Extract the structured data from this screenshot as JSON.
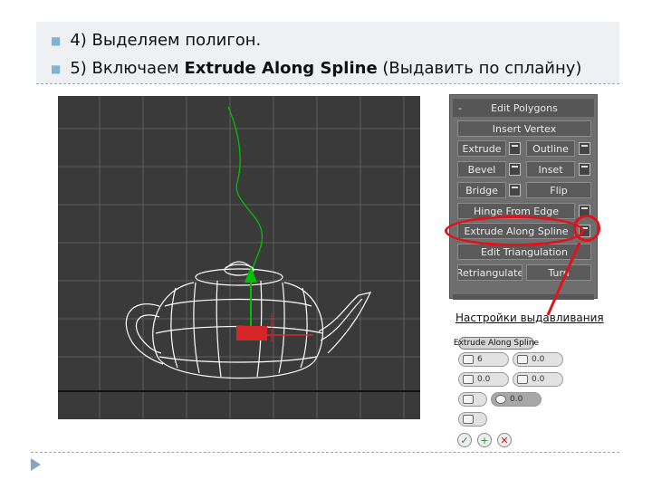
{
  "bullets": [
    {
      "text": "4) Выделяем полигон."
    },
    {
      "prefix": "5) Включаем ",
      "bold": "Extrude Along Spline",
      "suffix": " (Выдавить по сплайну)"
    }
  ],
  "panel": {
    "title": "Edit Polygons",
    "collapse": "-",
    "buttons": {
      "insert_vertex": "Insert Vertex",
      "extrude": "Extrude",
      "outline": "Outline",
      "bevel": "Bevel",
      "inset": "Inset",
      "bridge": "Bridge",
      "flip": "Flip",
      "hinge_from_edge": "Hinge From Edge",
      "extrude_along_spline": "Extrude Along Spline",
      "edit_triangulation": "Edit Triangulation",
      "retriangulate": "Retriangulate",
      "turn": "Turn"
    }
  },
  "settings_caption": "Настройки выдавливания",
  "mini": {
    "title": "Extrude Along Spline",
    "segments": "6",
    "taper_amount": "0.0",
    "taper_curve": "0.0",
    "twist": "0.0",
    "rotation": "0.0"
  },
  "colors": {
    "annotation_red": "#e0121a",
    "viewport_bg": "#3a3a3a",
    "spline_green": "#00c000",
    "selection_red": "#d42626"
  }
}
